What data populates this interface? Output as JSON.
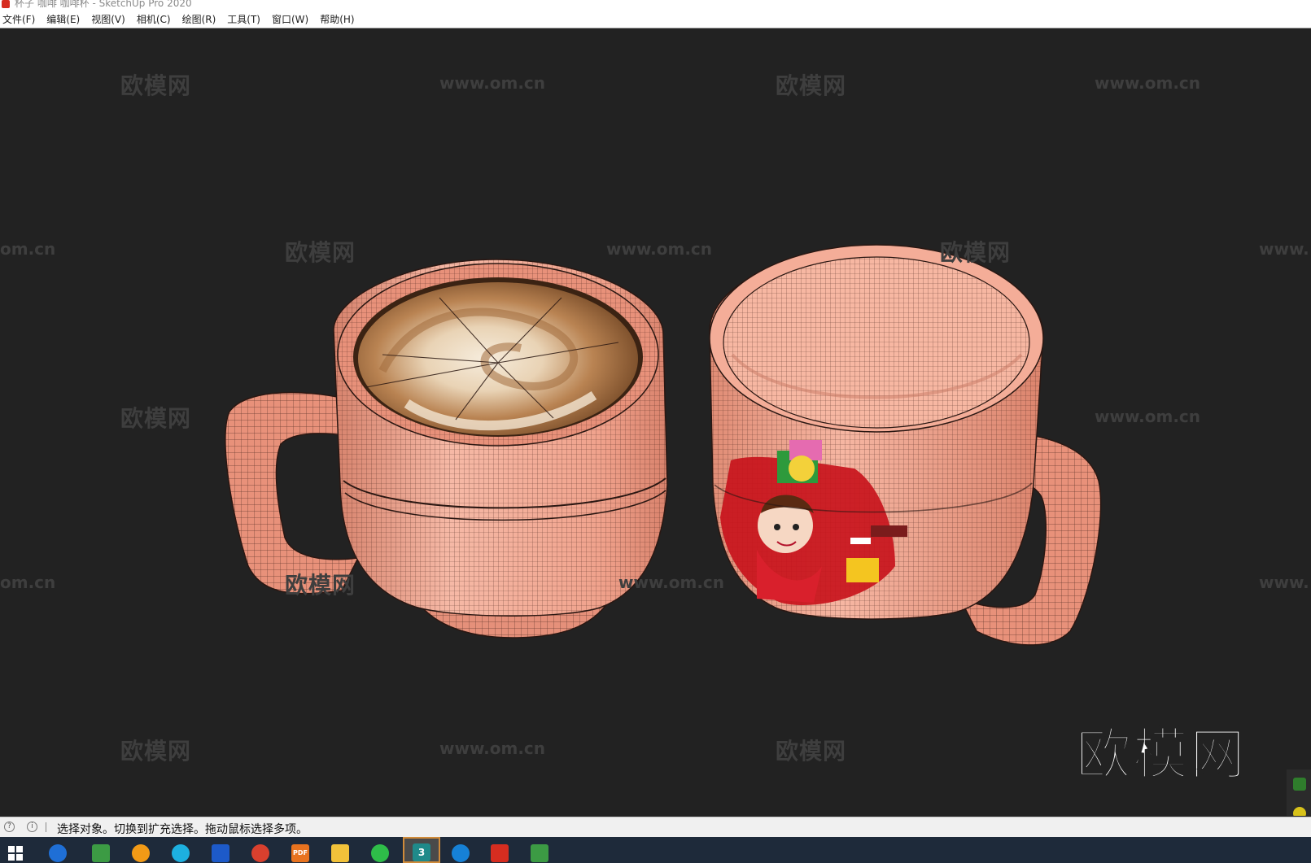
{
  "window": {
    "title": "杯子 咖啡 咖啡杯 - SketchUp Pro 2020"
  },
  "menu": [
    {
      "id": "file",
      "label": "文件(F)"
    },
    {
      "id": "edit",
      "label": "编辑(E)"
    },
    {
      "id": "view",
      "label": "视图(V)"
    },
    {
      "id": "camera",
      "label": "相机(C)"
    },
    {
      "id": "draw",
      "label": "绘图(R)"
    },
    {
      "id": "tools",
      "label": "工具(T)"
    },
    {
      "id": "window",
      "label": "窗口(W)"
    },
    {
      "id": "help",
      "label": "帮助(H)"
    }
  ],
  "watermarks": [
    "欧模网",
    "www.om.cn",
    "欧模网",
    "www.om.cn",
    "om.cn",
    "欧模网",
    "www.om.cn",
    "欧模网",
    "www.",
    "欧模网",
    "www.om.cn",
    "om.cn",
    "欧模网",
    "www.om.cn",
    "www.",
    "欧模网",
    "www.om.cn",
    "欧模网"
  ],
  "logo": "欧模网",
  "statusbar": {
    "message": "选择对象。切换到扩充选择。拖动鼠标选择多项。"
  },
  "taskbar": {
    "active_app_badge": "3",
    "pdf_badge": "PDF"
  },
  "colors": {
    "viewport_bg": "#222222",
    "mug_pink": "#f2a48f",
    "mug_inner": "#f7b7a2",
    "coffee_crema": "#8b5a2b",
    "coffee_foam": "#f3e7d6",
    "wire": "#2a1712",
    "decal_red": "#c8141c"
  },
  "icons": {
    "start": "windows-start-icon",
    "browser": "ie-browser-icon",
    "chat": "wechat-icon",
    "folder": "file-explorer-icon",
    "sketchup": "sketchup-icon"
  }
}
